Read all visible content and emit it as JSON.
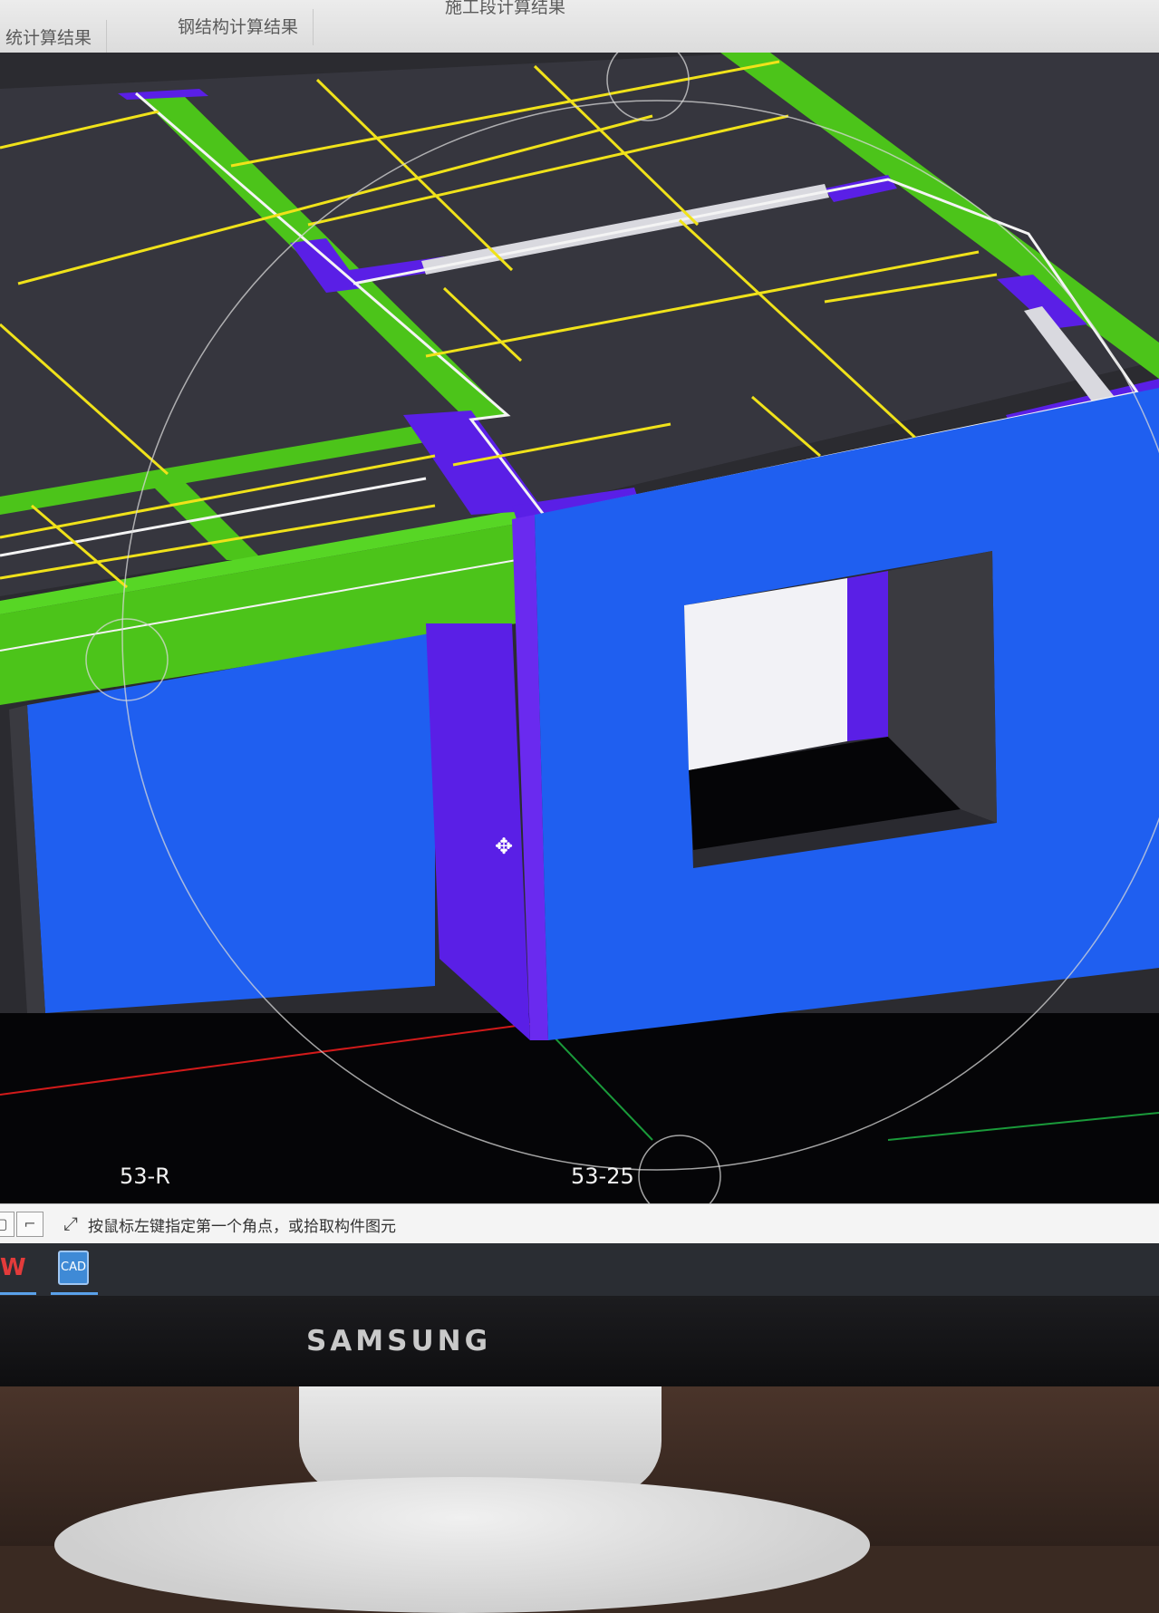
{
  "tabs": [
    {
      "label": "统计算结果"
    },
    {
      "label": "钢结构计算结果"
    },
    {
      "label": "施工段计算结果"
    }
  ],
  "viewport": {
    "axis_labels": [
      "53-R",
      "53-25"
    ],
    "colors": {
      "background": "#2b2b30",
      "wall": "#1f5ff0",
      "wall_side": "#5a1fe6",
      "beam": "#4cc41a",
      "rebar": "#f0e21a",
      "grid_red": "#d11a1a",
      "grid_green": "#1a9a3a"
    }
  },
  "statusbar": {
    "prompt": "按鼠标左键指定第一个角点，或拾取构件图元"
  },
  "taskbar": {
    "apps": [
      {
        "name": "wps-icon",
        "label": "W"
      },
      {
        "name": "cad-icon",
        "label": "CAD"
      }
    ]
  },
  "monitor": {
    "brand": "SAMSUNG"
  }
}
